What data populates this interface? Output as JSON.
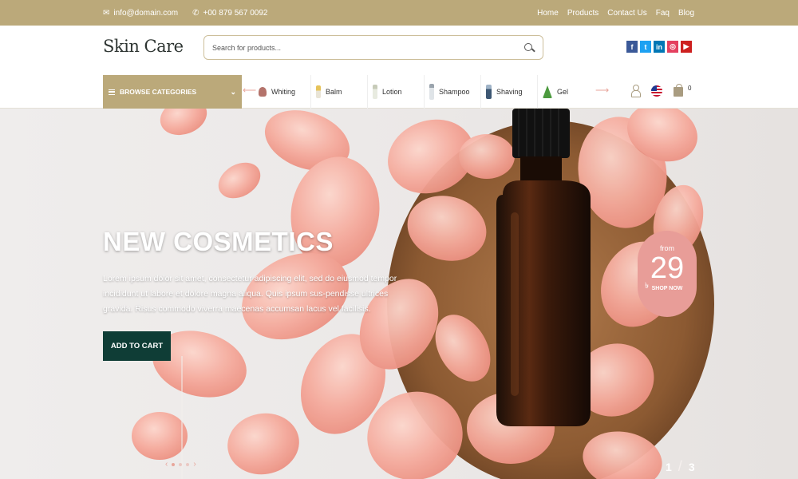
{
  "topbar": {
    "email": "info@domain.com",
    "phone": "+00 879 567 0092",
    "links": [
      "Home",
      "Products",
      "Contact Us",
      "Faq",
      "Blog"
    ]
  },
  "header": {
    "logo": "Skin Care",
    "search_placeholder": "Search for products...",
    "social": [
      {
        "icon": "facebook-icon",
        "glyph": "f",
        "color": "#3b5998"
      },
      {
        "icon": "twitter-icon",
        "glyph": "t",
        "color": "#1da1f2"
      },
      {
        "icon": "linkedin-icon",
        "glyph": "in",
        "color": "#0077b5"
      },
      {
        "icon": "instagram-icon",
        "glyph": "◎",
        "color": "#e4405f"
      },
      {
        "icon": "youtube-icon",
        "glyph": "▶",
        "color": "#cd201f"
      }
    ]
  },
  "nav": {
    "browse_label": "BROWSE CATEGORIES",
    "categories": [
      {
        "label": "Whiting",
        "color": "#b4736b"
      },
      {
        "label": "Balm",
        "color": "#e6c35a"
      },
      {
        "label": "Lotion",
        "color": "#cfd8c5"
      },
      {
        "label": "Shampoo",
        "color": "#b7c1c9"
      },
      {
        "label": "Shaving",
        "color": "#3d5773"
      },
      {
        "label": "Gel",
        "color": "#4c9a3f"
      }
    ],
    "cart_count": "0"
  },
  "hero": {
    "title": "NEW COSMETICS",
    "text": "Lorem ipsum dolor sit amet, consectetur adipiscing elit, sed do eiusmod tempor incididunt ut labore et dolore magna aliqua. Quis ipsum sus-pendisse ultrices gravida. Risus commodo viverra maecenas accumsan lacus vel facilisis.",
    "button": "ADD TO CART",
    "badge": {
      "from": "from",
      "currency": "৳",
      "amount": "29",
      "shop": "SHOP NOW"
    },
    "slide_current": "1",
    "slide_total": "3"
  },
  "colors": {
    "accent": "#bba97a",
    "button": "#0f3d36",
    "badge": "#e89d98"
  }
}
